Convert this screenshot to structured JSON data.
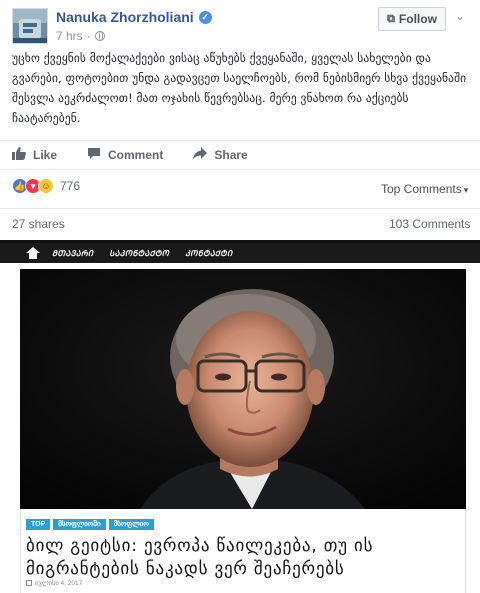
{
  "post": {
    "author": "Nanuka Zhorzholiani",
    "time": "7 hrs",
    "follow_label": "Follow",
    "text": "უცხო ქვეყნის მოქალაქეები ვისაც აწუხებს ქვეყანაში, ყველას სახელები და გვარები, ფოტოებით უნდა გადავცეთ საელჩოებს, რომ ნებისმიერ სხვა ქვეყანაში შესვლა აეკრძალოთ! მათ ოჯახის წევრებსაც. მერე ვნახოთ რა აქციებს ჩაატარებენ.",
    "actions": {
      "like": "Like",
      "comment": "Comment",
      "share": "Share"
    },
    "reaction_count": "776",
    "top_comments": "Top Comments",
    "shares": "27 shares",
    "comments": "103 Comments"
  },
  "site": {
    "nav": [
      "ᲛᲗᲐᲕᲐᲠᲘ",
      "ᲡᲐᲙᲝᲜᲢᲐᲥᲢᲝ",
      "ᲙᲝᲜᲢᲐᲥᲢᲘ"
    ],
    "tags": [
      "TOP",
      "მსოფლიოში",
      "მსოფლიო"
    ],
    "headline": "ბილ გეიტსი: ევროპა წაილეკება, თუ ის მიგრანტების ნაკადს ვერ შეაჩერებს",
    "date": "ივლისი 4, 2017"
  },
  "colors": {
    "link": "#365899",
    "tag": "#2a9fd6",
    "nav_bg": "#1a1a1a"
  }
}
